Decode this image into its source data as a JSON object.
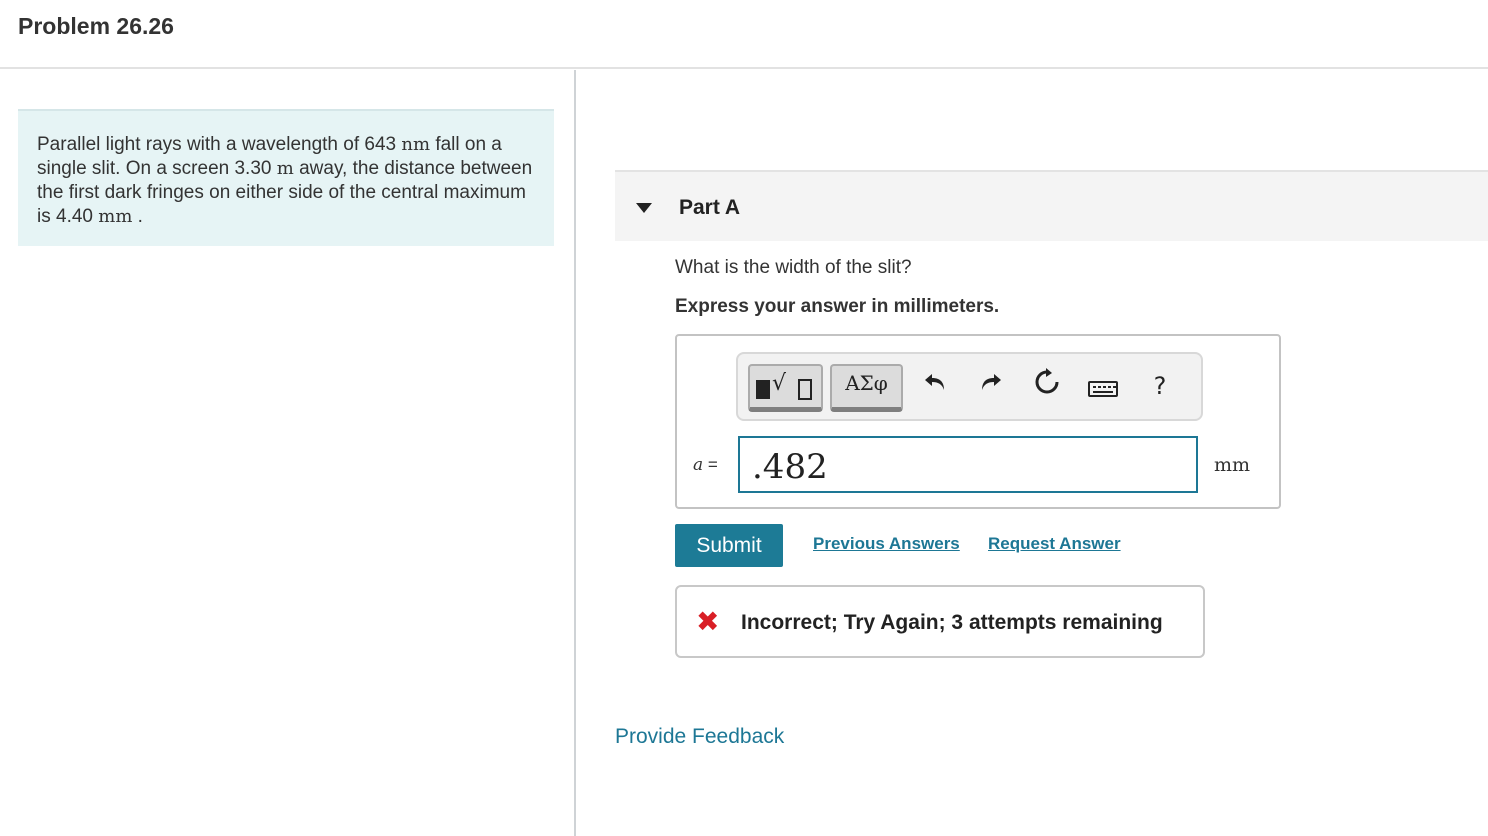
{
  "header": {
    "title": "Problem 26.26"
  },
  "problem": {
    "segments": [
      {
        "text": "Parallel light rays with a wavelength of 643 ",
        "math": false
      },
      {
        "text": "nm",
        "math": true
      },
      {
        "text": " fall on a single slit. On a screen 3.30 ",
        "math": false
      },
      {
        "text": "m",
        "math": true
      },
      {
        "text": " away, the distance between the first dark fringes on either side of the central maximum is 4.40 ",
        "math": false
      },
      {
        "text": "mm",
        "math": true
      },
      {
        "text": " .",
        "math": false
      }
    ]
  },
  "part": {
    "title": "Part A",
    "question": "What is the width of the slit?",
    "instruction": "Express your answer in millimeters."
  },
  "toolbar": {
    "symbols_label": "ΑΣφ",
    "help_label": "?"
  },
  "answer": {
    "variable": "a",
    "equals": "=",
    "value": ".482",
    "unit": "mm"
  },
  "actions": {
    "submit_label": "Submit",
    "previous_answers": "Previous Answers",
    "request_answer": "Request Answer"
  },
  "feedback": {
    "icon": "✖",
    "message": "Incorrect; Try Again; 3 attempts remaining",
    "icon_color": "#d91f26"
  },
  "footer": {
    "provide_feedback": "Provide Feedback"
  },
  "colors": {
    "accent": "#1d7795",
    "button": "#1d7b96",
    "problem_bg": "#e6f4f5"
  }
}
